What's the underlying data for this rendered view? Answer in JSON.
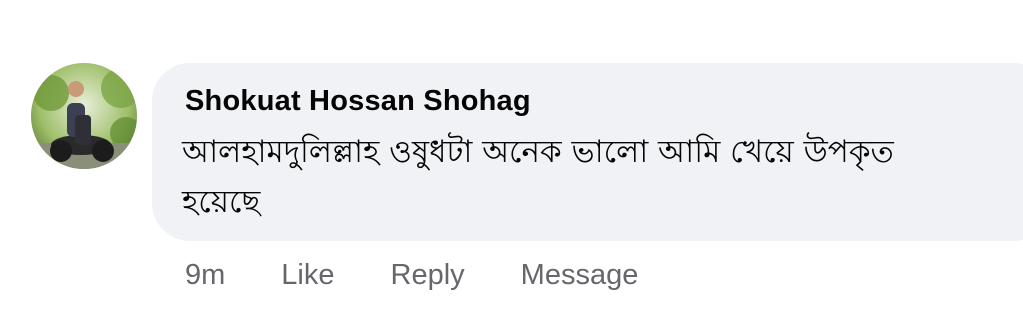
{
  "comment": {
    "author": "Shokuat Hossan Shohag",
    "text": "আলহামদুলিল্লাহ ওষুধটা অনেক ভালো আমি খেয়ে উপকৃত হয়েছে",
    "avatar_icon": "user-photo-avatar"
  },
  "actions": {
    "time": "9m",
    "like": "Like",
    "reply": "Reply",
    "message": "Message"
  },
  "colors": {
    "bubble_bg": "#f0f2f5",
    "text": "#050505",
    "secondary_text": "#65676b"
  }
}
